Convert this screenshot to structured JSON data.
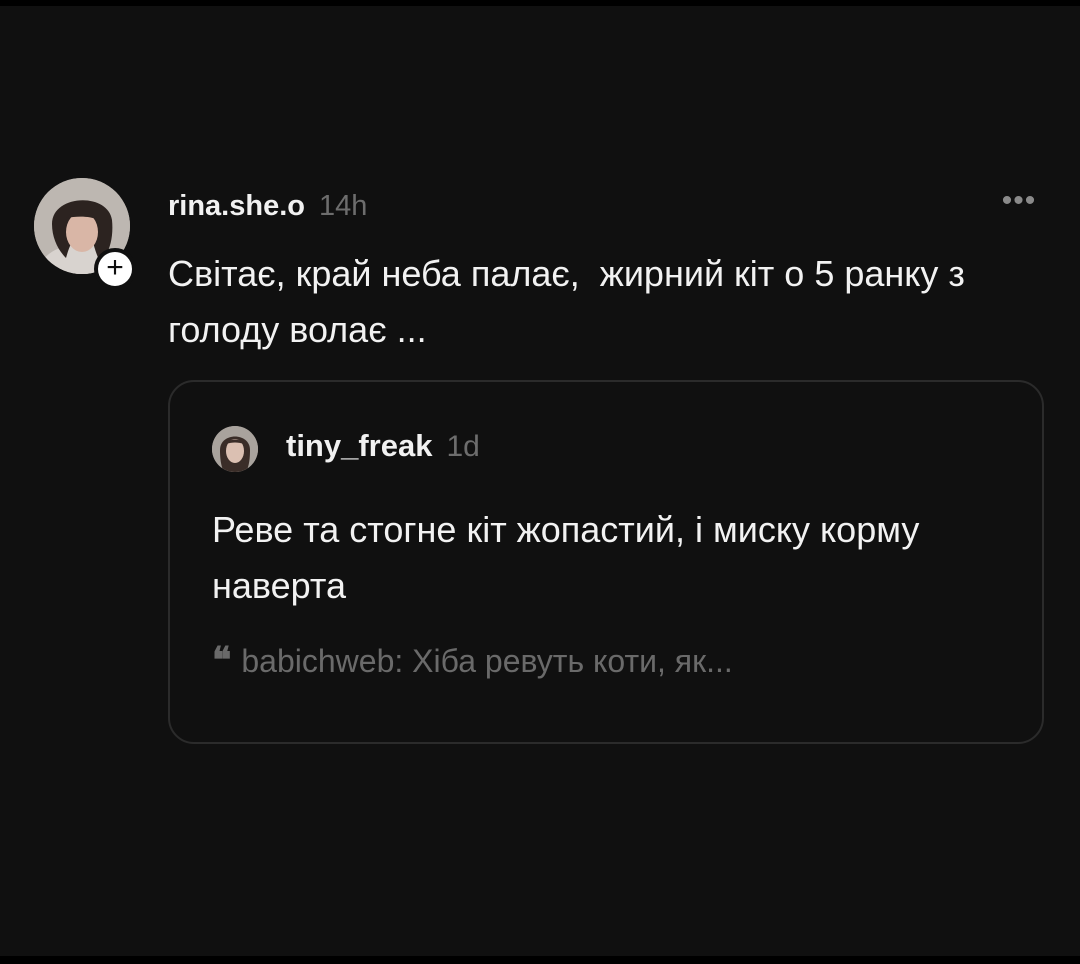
{
  "post": {
    "author": "rina.she.o",
    "time": "14h",
    "more_icon": "more-horizontal-icon",
    "follow_icon": "plus-icon",
    "text": "Світає, край неба палає,  жирний кіт о 5 ранку з голоду волає ..."
  },
  "quoted_post": {
    "author": "tiny_freak",
    "time": "1d",
    "text": "Реве та стогне кіт жопастий, і миску корму наверта",
    "reply_icon": "quote-icon",
    "reply_preview": "babichweb: Хіба ревуть коти, як..."
  },
  "colors": {
    "background": "#101010",
    "primary_text": "#f2f2f2",
    "secondary_text": "#6d6d6d",
    "card_border": "#2b2b2b"
  }
}
